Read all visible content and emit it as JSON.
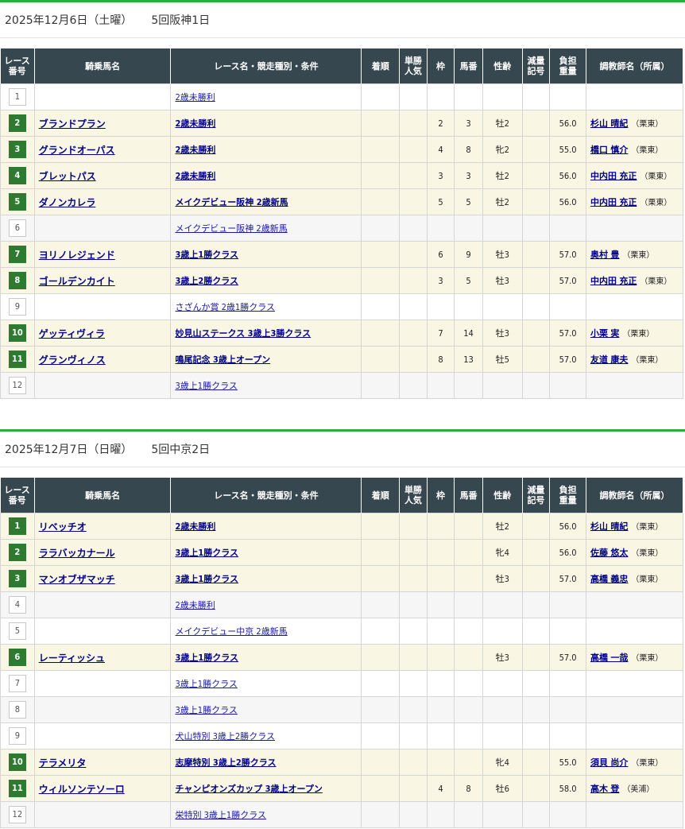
{
  "days": [
    {
      "date": "2025年12月6日（土曜）",
      "meet": "5回阪神1日",
      "columns": [
        "レース\n番号",
        "騎乗馬名",
        "レース名・競走種別・条件",
        "着順",
        "単勝\n人気",
        "枠",
        "馬番",
        "性齢",
        "減量\n記号",
        "負担\n重量",
        "調教師名（所属）"
      ],
      "races": [
        {
          "no": "1",
          "horse": "",
          "race": "2歳未勝利",
          "place": "",
          "pop": "",
          "waku": "",
          "uma": "",
          "sex": "",
          "gen": "",
          "wt": "",
          "trainer": "",
          "aff": ""
        },
        {
          "no": "2",
          "horse": "ブランドプラン",
          "race": "2歳未勝利",
          "place": "",
          "pop": "",
          "waku": "2",
          "uma": "3",
          "sex": "牡2",
          "gen": "",
          "wt": "56.0",
          "trainer": "杉山 晴紀",
          "aff": "（栗東）"
        },
        {
          "no": "3",
          "horse": "グランドオーパス",
          "race": "2歳未勝利",
          "place": "",
          "pop": "",
          "waku": "4",
          "uma": "8",
          "sex": "牝2",
          "gen": "",
          "wt": "55.0",
          "trainer": "橋口 慎介",
          "aff": "（栗東）"
        },
        {
          "no": "4",
          "horse": "ブレットパス",
          "race": "2歳未勝利",
          "place": "",
          "pop": "",
          "waku": "3",
          "uma": "3",
          "sex": "牡2",
          "gen": "",
          "wt": "56.0",
          "trainer": "中内田 充正",
          "aff": "（栗東）"
        },
        {
          "no": "5",
          "horse": "ダノンカレラ",
          "race": "メイクデビュー阪神 2歳新馬",
          "place": "",
          "pop": "",
          "waku": "5",
          "uma": "5",
          "sex": "牡2",
          "gen": "",
          "wt": "56.0",
          "trainer": "中内田 充正",
          "aff": "（栗東）"
        },
        {
          "no": "6",
          "horse": "",
          "race": "メイクデビュー阪神 2歳新馬",
          "place": "",
          "pop": "",
          "waku": "",
          "uma": "",
          "sex": "",
          "gen": "",
          "wt": "",
          "trainer": "",
          "aff": ""
        },
        {
          "no": "7",
          "horse": "ヨリノレジェンド",
          "race": "3歳上1勝クラス",
          "place": "",
          "pop": "",
          "waku": "6",
          "uma": "9",
          "sex": "牡3",
          "gen": "",
          "wt": "57.0",
          "trainer": "奥村 豊",
          "aff": "（栗東）"
        },
        {
          "no": "8",
          "horse": "ゴールデンカイト",
          "race": "3歳上2勝クラス",
          "place": "",
          "pop": "",
          "waku": "3",
          "uma": "5",
          "sex": "牡3",
          "gen": "",
          "wt": "57.0",
          "trainer": "中内田 充正",
          "aff": "（栗東）"
        },
        {
          "no": "9",
          "horse": "",
          "race": "さざんか賞 2歳1勝クラス",
          "place": "",
          "pop": "",
          "waku": "",
          "uma": "",
          "sex": "",
          "gen": "",
          "wt": "",
          "trainer": "",
          "aff": ""
        },
        {
          "no": "10",
          "horse": "ゲッティヴィラ",
          "race": "妙見山ステークス 3歳上3勝クラス",
          "place": "",
          "pop": "",
          "waku": "7",
          "uma": "14",
          "sex": "牡3",
          "gen": "",
          "wt": "57.0",
          "trainer": "小栗 実",
          "aff": "（栗東）"
        },
        {
          "no": "11",
          "horse": "グランヴィノス",
          "race": "鳴尾記念 3歳上オープン",
          "place": "",
          "pop": "",
          "waku": "8",
          "uma": "13",
          "sex": "牡5",
          "gen": "",
          "wt": "57.0",
          "trainer": "友道 康夫",
          "aff": "（栗東）"
        },
        {
          "no": "12",
          "horse": "",
          "race": "3歳上1勝クラス",
          "place": "",
          "pop": "",
          "waku": "",
          "uma": "",
          "sex": "",
          "gen": "",
          "wt": "",
          "trainer": "",
          "aff": ""
        }
      ]
    },
    {
      "date": "2025年12月7日（日曜）",
      "meet": "5回中京2日",
      "columns": [
        "レース\n番号",
        "騎乗馬名",
        "レース名・競走種別・条件",
        "着順",
        "単勝\n人気",
        "枠",
        "馬番",
        "性齢",
        "減量\n記号",
        "負担\n重量",
        "調教師名（所属）"
      ],
      "races": [
        {
          "no": "1",
          "horse": "リベッチオ",
          "race": "2歳未勝利",
          "place": "",
          "pop": "",
          "waku": "",
          "uma": "",
          "sex": "牡2",
          "gen": "",
          "wt": "56.0",
          "trainer": "杉山 晴紀",
          "aff": "（栗東）"
        },
        {
          "no": "2",
          "horse": "ララバッカナール",
          "race": "3歳上1勝クラス",
          "place": "",
          "pop": "",
          "waku": "",
          "uma": "",
          "sex": "牝4",
          "gen": "",
          "wt": "56.0",
          "trainer": "佐藤 悠太",
          "aff": "（栗東）"
        },
        {
          "no": "3",
          "horse": "マンオブザマッチ",
          "race": "3歳上1勝クラス",
          "place": "",
          "pop": "",
          "waku": "",
          "uma": "",
          "sex": "牡3",
          "gen": "",
          "wt": "57.0",
          "trainer": "高橋 義忠",
          "aff": "（栗東）"
        },
        {
          "no": "4",
          "horse": "",
          "race": "2歳未勝利",
          "place": "",
          "pop": "",
          "waku": "",
          "uma": "",
          "sex": "",
          "gen": "",
          "wt": "",
          "trainer": "",
          "aff": ""
        },
        {
          "no": "5",
          "horse": "",
          "race": "メイクデビュー中京 2歳新馬",
          "place": "",
          "pop": "",
          "waku": "",
          "uma": "",
          "sex": "",
          "gen": "",
          "wt": "",
          "trainer": "",
          "aff": ""
        },
        {
          "no": "6",
          "horse": "レーティッシュ",
          "race": "3歳上1勝クラス",
          "place": "",
          "pop": "",
          "waku": "",
          "uma": "",
          "sex": "牡3",
          "gen": "",
          "wt": "57.0",
          "trainer": "高橋 一哉",
          "aff": "（栗東）"
        },
        {
          "no": "7",
          "horse": "",
          "race": "3歳上1勝クラス",
          "place": "",
          "pop": "",
          "waku": "",
          "uma": "",
          "sex": "",
          "gen": "",
          "wt": "",
          "trainer": "",
          "aff": ""
        },
        {
          "no": "8",
          "horse": "",
          "race": "3歳上1勝クラス",
          "place": "",
          "pop": "",
          "waku": "",
          "uma": "",
          "sex": "",
          "gen": "",
          "wt": "",
          "trainer": "",
          "aff": ""
        },
        {
          "no": "9",
          "horse": "",
          "race": "犬山特別 3歳上2勝クラス",
          "place": "",
          "pop": "",
          "waku": "",
          "uma": "",
          "sex": "",
          "gen": "",
          "wt": "",
          "trainer": "",
          "aff": ""
        },
        {
          "no": "10",
          "horse": "テラメリタ",
          "race": "志摩特別 3歳上2勝クラス",
          "place": "",
          "pop": "",
          "waku": "",
          "uma": "",
          "sex": "牝4",
          "gen": "",
          "wt": "55.0",
          "trainer": "須貝 尚介",
          "aff": "（栗東）"
        },
        {
          "no": "11",
          "horse": "ウィルソンテソーロ",
          "race": "チャンピオンズカップ 3歳上オープン",
          "place": "",
          "pop": "",
          "waku": "4",
          "uma": "8",
          "sex": "牡6",
          "gen": "",
          "wt": "58.0",
          "trainer": "高木 登",
          "aff": "（美浦）"
        },
        {
          "no": "12",
          "horse": "",
          "race": "栄特別 3歳上1勝クラス",
          "place": "",
          "pop": "",
          "waku": "",
          "uma": "",
          "sex": "",
          "gen": "",
          "wt": "",
          "trainer": "",
          "aff": ""
        }
      ]
    }
  ]
}
